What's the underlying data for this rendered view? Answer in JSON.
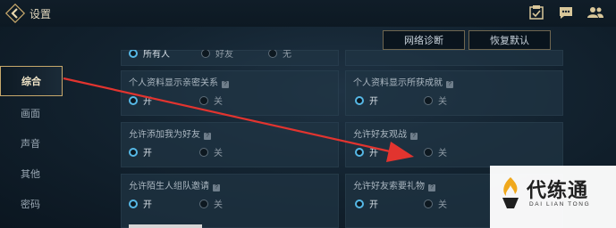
{
  "header": {
    "title": "设置"
  },
  "actions": {
    "network_diag": "网络诊断",
    "restore_default": "恢复默认"
  },
  "sidebar": {
    "items": [
      {
        "label": "综合",
        "active": true
      },
      {
        "label": "画面"
      },
      {
        "label": "声音"
      },
      {
        "label": "其他"
      },
      {
        "label": "密码"
      }
    ]
  },
  "partial_top_row": {
    "options": [
      "所有人",
      "好友",
      "无"
    ]
  },
  "settings": [
    {
      "label": "个人资料显示亲密关系",
      "on": "开",
      "off": "关",
      "selected": "on"
    },
    {
      "label": "个人资料显示所获成就",
      "on": "开",
      "off": "关",
      "selected": "on"
    },
    {
      "label": "允许添加我为好友",
      "on": "开",
      "off": "关",
      "selected": "on"
    },
    {
      "label": "允许好友观战",
      "on": "开",
      "off": "关",
      "selected": "on"
    },
    {
      "label": "允许陌生人组队邀请",
      "on": "开",
      "off": "关",
      "selected": "on"
    },
    {
      "label": "允许好友索要礼物",
      "on": "开",
      "off": "关",
      "selected": "on"
    }
  ],
  "watermark": {
    "title": "代练通",
    "subtitle": "DAI LIAN TONG"
  },
  "colors": {
    "accent_gold": "#c7a86b",
    "radio_on": "#56b8e6",
    "arrow": "#e2342f"
  }
}
